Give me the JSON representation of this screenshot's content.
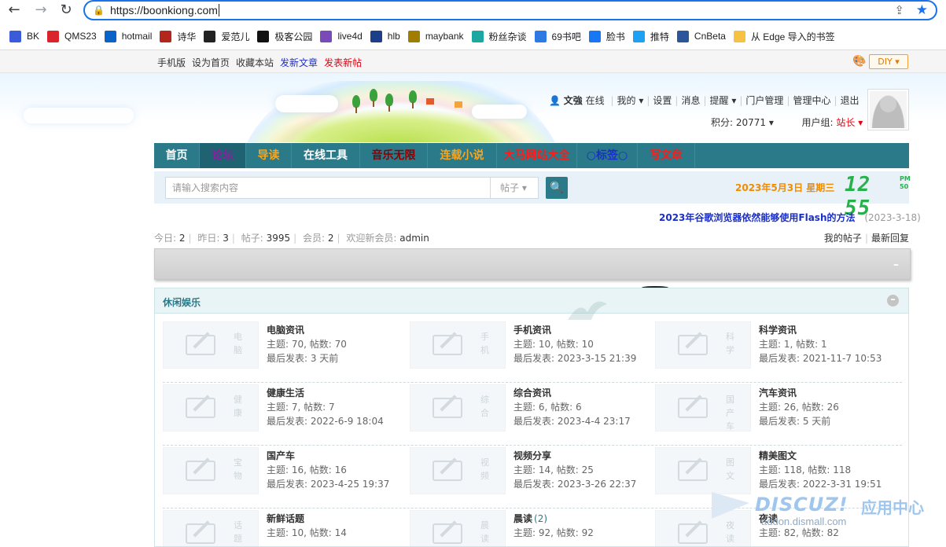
{
  "browser": {
    "url": "https://boonkiong.com",
    "bookmarks": [
      {
        "label": "BK",
        "icon": "bk-icon",
        "color": "#3b5bdb"
      },
      {
        "label": "QMS23",
        "icon": "qms-icon",
        "color": "#d9232d"
      },
      {
        "label": "hotmail",
        "icon": "outlook-icon",
        "color": "#0a64c8"
      },
      {
        "label": "诗华",
        "icon": "shihua-icon",
        "color": "#b3261e"
      },
      {
        "label": "爱范儿",
        "icon": "ifanr-icon",
        "color": "#222222"
      },
      {
        "label": "极客公园",
        "icon": "geekpark-icon",
        "color": "#111111"
      },
      {
        "label": "live4d",
        "icon": "live4d-icon",
        "color": "#7a4ab8"
      },
      {
        "label": "hlb",
        "icon": "hlb-icon",
        "color": "#1d3f8a"
      },
      {
        "label": "maybank",
        "icon": "maybank-icon",
        "color": "#a07c00"
      },
      {
        "label": "粉丝杂谈",
        "icon": "fans-icon",
        "color": "#1aa8a0"
      },
      {
        "label": "69书吧",
        "icon": "69shuba-icon",
        "color": "#2c7be5"
      },
      {
        "label": "脸书",
        "icon": "facebook-icon",
        "color": "#1877f2"
      },
      {
        "label": "推特",
        "icon": "twitter-icon",
        "color": "#1da1f2"
      },
      {
        "label": "CnBeta",
        "icon": "cnbeta-icon",
        "color": "#2b579a"
      },
      {
        "label": "从 Edge 导入的书签",
        "icon": "folder-icon",
        "color": "#f5c242"
      }
    ]
  },
  "toolbar": {
    "links": [
      {
        "label": "手机版",
        "style": "normal"
      },
      {
        "label": "设为首页",
        "style": "normal"
      },
      {
        "label": "收藏本站",
        "style": "normal"
      },
      {
        "label": "发新文章",
        "style": "blue"
      },
      {
        "label": "发表新帖",
        "style": "red"
      }
    ],
    "diy_label": "DIY ▾"
  },
  "user": {
    "name": "文強",
    "status": "在线",
    "menu": [
      "我的 ▾",
      "设置",
      "消息",
      "提醒 ▾",
      "门户管理",
      "管理中心",
      "退出"
    ],
    "points_label": "积分: 20771 ▾",
    "group_prefix": "用户组: ",
    "group_value": "站长 ▾"
  },
  "nav": [
    {
      "label": "首页",
      "color": "#ffffff",
      "active": false
    },
    {
      "label": "论坛",
      "color": "#8b1fa0",
      "active": true
    },
    {
      "label": "导读",
      "color": "#f5a623",
      "active": false
    },
    {
      "label": "在线工具",
      "color": "#ffffff",
      "active": false
    },
    {
      "label": "音乐无限",
      "color": "#8b0000",
      "active": false
    },
    {
      "label": "连载小说",
      "color": "#f5a623",
      "active": false
    },
    {
      "label": "大马网站大全",
      "color": "#ff1a1a",
      "active": false
    },
    {
      "label": "○标签○",
      "color": "#1a2ec8",
      "active": false
    },
    {
      "label": "写文章",
      "color": "#ff1a1a",
      "active": false
    }
  ],
  "search": {
    "placeholder": "请输入搜索内容",
    "type_label": "帖子 ▾"
  },
  "clock": {
    "date": "2023年5月3日 星期三",
    "time": "12 55",
    "ampm": "PM",
    "seconds": "50"
  },
  "announcement": {
    "title": "2023年谷歌浏览器依然能够使用Flash的方法",
    "date": "(2023-3-18)"
  },
  "stats": {
    "today_label": "今日: ",
    "today": "2",
    "yesterday_label": "昨日: ",
    "yesterday": "3",
    "posts_label": "帖子: ",
    "posts": "3995",
    "members_label": "会员: ",
    "members": "2",
    "newest_label": "欢迎新会员: ",
    "newest": "admin",
    "my_posts": "我的帖子",
    "latest_replies": "最新回复"
  },
  "forum": {
    "title": "休闲娱乐",
    "boards": [
      {
        "name": "电脑资讯",
        "thumb": "电脑",
        "today": "",
        "meta1": "主题: 70, 帖数: 70",
        "meta2": "最后发表: 3 天前"
      },
      {
        "name": "手机资讯",
        "thumb": "手机",
        "today": "",
        "meta1": "主题: 10, 帖数: 10",
        "meta2": "最后发表: 2023-3-15 21:39"
      },
      {
        "name": "科学资讯",
        "thumb": "科学",
        "today": "",
        "meta1": "主题: 1, 帖数: 1",
        "meta2": "最后发表: 2021-11-7 10:53"
      },
      {
        "name": "健康生活",
        "thumb": "健康",
        "today": "",
        "meta1": "主题: 7, 帖数: 7",
        "meta2": "最后发表: 2022-6-9 18:04"
      },
      {
        "name": "综合资讯",
        "thumb": "综合",
        "today": "",
        "meta1": "主题: 6, 帖数: 6",
        "meta2": "最后发表: 2023-4-4 23:17"
      },
      {
        "name": "汽车资讯",
        "thumb": "国产车",
        "today": "",
        "meta1": "主题: 26, 帖数: 26",
        "meta2": "最后发表: 5 天前"
      },
      {
        "name": "国产车",
        "thumb": "宝物",
        "today": "",
        "meta1": "主题: 16, 帖数: 16",
        "meta2": "最后发表: 2023-4-25 19:37"
      },
      {
        "name": "视频分享",
        "thumb": "视频",
        "today": "",
        "meta1": "主题: 14, 帖数: 25",
        "meta2": "最后发表: 2023-3-26 22:37"
      },
      {
        "name": "精美图文",
        "thumb": "图文",
        "today": "",
        "meta1": "主题: 118, 帖数: 118",
        "meta2": "最后发表: 2022-3-31 19:51"
      },
      {
        "name": "新鲜话题",
        "thumb": "话题",
        "today": "",
        "meta1": "主题: 10, 帖数: 14",
        "meta2": ""
      },
      {
        "name": "晨读",
        "thumb": "晨读",
        "today": "(2)",
        "meta1": "主题: 92, 帖数: 92",
        "meta2": ""
      },
      {
        "name": "夜读",
        "thumb": "夜读",
        "today": "",
        "meta1": "主题: 82, 帖数: 82",
        "meta2": ""
      }
    ]
  },
  "watermark": {
    "brand": "DISCUZ!",
    "cn": "应用中心",
    "domain": "addon.dismall.com"
  }
}
